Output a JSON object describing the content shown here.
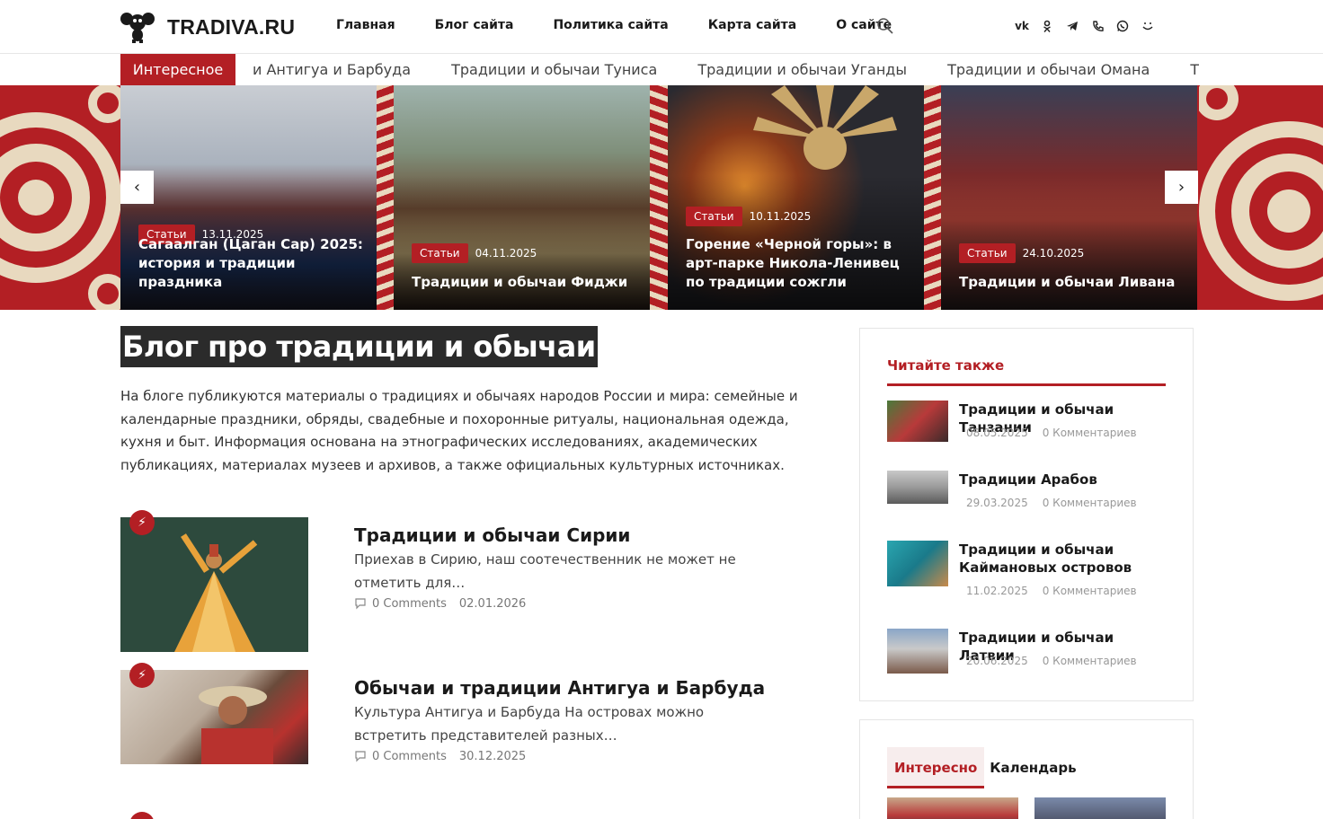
{
  "site": {
    "logo_text": "TRADIVA.RU",
    "accent": "#b31f24"
  },
  "nav": {
    "items": [
      "Главная",
      "Блог сайта",
      "Политика сайта",
      "Карта сайта",
      "О сайте"
    ]
  },
  "socials": [
    "vk-icon",
    "ok-icon",
    "telegram-icon",
    "phone-icon",
    "whatsapp-icon",
    "max-icon"
  ],
  "ticker": {
    "label": "Интересное",
    "items": [
      "и Антигуа и Барбуда",
      "Традиции и обычаи Туниса",
      "Традиции и обычаи Уганды",
      "Традиции и обычаи Омана",
      "Традиции и обычаи"
    ]
  },
  "slider": {
    "prev": "‹",
    "next": "›",
    "slides": [
      {
        "category": "Статьи",
        "date": "13.11.2025",
        "title": "Сагаалган (Цаган Сар) 2025: история и традиции праздника"
      },
      {
        "category": "Статьи",
        "date": "04.11.2025",
        "title": "Традиции и обычаи Фиджи"
      },
      {
        "category": "Статьи",
        "date": "10.11.2025",
        "title": "Горение «Черной горы»: в арт-парке Никола-Ленивец по традиции сожгли «масленично"
      },
      {
        "category": "Статьи",
        "date": "24.10.2025",
        "title": "Традиции и обычаи Ливана"
      }
    ]
  },
  "main": {
    "title": "Блог про традиции и обычаи",
    "intro": "На блоге публикуются материалы о традициях и обычаях народов России и мира: семейные и календарные праздники, обряды, свадебные и похоронные ритуалы, национальная одежда, кухня и быт. Информация основана на этнографических исследованиях, академических публикациях, материалах музеев и архивов, а также официальных культурных источниках.",
    "posts": [
      {
        "title": "Традиции и обычаи Сирии",
        "excerpt": "Приехав в Сирию, наш соотечественник не может не отметить для…",
        "comments": "0 Comments",
        "date": "02.01.2026"
      },
      {
        "title": "Обычаи и традиции Антигуа и Барбуда",
        "excerpt": "Культура Антигуа и Барбуда На островах можно встретить представителей разных…",
        "comments": "0 Comments",
        "date": "30.12.2025"
      }
    ]
  },
  "sidebar": {
    "read_also": {
      "title": "Читайте также",
      "items": [
        {
          "title": "Традиции и обычаи Танзании",
          "date": "08.05.2025",
          "comments": "0 Комментариев"
        },
        {
          "title": "Традиции Арабов",
          "date": "29.03.2025",
          "comments": "0 Комментариев"
        },
        {
          "title": "Традиции и обычаи Каймановых островов",
          "date": "11.02.2025",
          "comments": "0 Комментариев"
        },
        {
          "title": "Традиции и обычаи Латвии",
          "date": "20.06.2025",
          "comments": "0 Комментариев"
        }
      ]
    },
    "tabs": [
      "Интересно",
      "Календарь"
    ]
  }
}
